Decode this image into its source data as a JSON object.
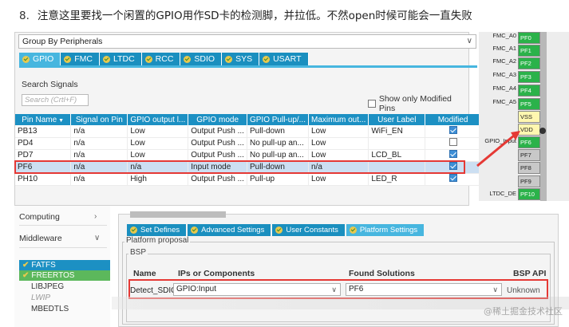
{
  "heading": {
    "number": "8.",
    "text": "注意这里要找一个闲置的GPIO用作SD卡的检测脚，并拉低。不然open时候可能会一直失败"
  },
  "top_panel": {
    "group_by": "Group By Peripherals",
    "tabs": [
      "GPIO",
      "FMC",
      "LTDC",
      "RCC",
      "SDIO",
      "SYS",
      "USART"
    ],
    "active_tab": "GPIO",
    "search_label": "Search Signals",
    "search_placeholder": "Search (Crtl+F)",
    "show_modified_label": "Show only Modified Pins",
    "columns": [
      "Pin Name",
      "Signal on Pin",
      "GPIO output l...",
      "GPIO mode",
      "GPIO Pull-up/...",
      "Maximum out...",
      "User Label",
      "Modified"
    ],
    "rows": [
      {
        "pin": "PB13",
        "signal": "n/a",
        "output": "Low",
        "mode": "Output Push ...",
        "pull": "Pull-down",
        "max": "Low",
        "label": "WiFi_EN",
        "modified": true
      },
      {
        "pin": "PD4",
        "signal": "n/a",
        "output": "Low",
        "mode": "Output Push ...",
        "pull": "No pull-up an...",
        "max": "Low",
        "label": "",
        "modified": false
      },
      {
        "pin": "PD7",
        "signal": "n/a",
        "output": "Low",
        "mode": "Output Push ...",
        "pull": "No pull-up an...",
        "max": "Low",
        "label": "LCD_BL",
        "modified": true
      },
      {
        "pin": "PF6",
        "signal": "n/a",
        "output": "n/a",
        "mode": "Input mode",
        "pull": "Pull-down",
        "max": "n/a",
        "label": "",
        "modified": true
      },
      {
        "pin": "PH10",
        "signal": "n/a",
        "output": "High",
        "mode": "Output Push ...",
        "pull": "Pull-up",
        "max": "Low",
        "label": "LED_R",
        "modified": true
      }
    ]
  },
  "pin_strip": {
    "labels": [
      "FMC_A0",
      "FMC_A1",
      "FMC_A2",
      "FMC_A3",
      "FMC_A4",
      "FMC_A5",
      "GPIO_Input",
      "LTDC_DE"
    ],
    "pins": [
      "PF0",
      "PF1",
      "PF2",
      "PF3",
      "PF4",
      "PF5",
      "VSS",
      "VDD",
      "PF6",
      "PF7",
      "PF8",
      "PF9",
      "PF10"
    ]
  },
  "tree": {
    "categories": [
      "Computing",
      "Middleware"
    ],
    "items": [
      "FATFS",
      "FREERTOS",
      "LIBJPEG",
      "LWIP",
      "MBEDTLS"
    ]
  },
  "bottom_panel": {
    "tabs": [
      "Set Defines",
      "Advanced Settings",
      "User Constants",
      "Platform Settings"
    ],
    "active_tab": "Platform Settings",
    "platform_legend": "Platform proposal",
    "bsp_legend": "BSP",
    "col_name": "Name",
    "col_ips": "IPs or Components",
    "col_found": "Found Solutions",
    "col_api": "BSP API",
    "row": {
      "name": "Detect_SDIO",
      "ip": "GPIO:Input",
      "found": "PF6",
      "api": "Unknown"
    }
  },
  "watermark": "@稀土掘金技术社区",
  "colors": {
    "tab_blue": "#1a8fbf",
    "header_blue": "#1c90c3",
    "pin_green": "#2bb24a",
    "highlight_red": "#e53935"
  }
}
